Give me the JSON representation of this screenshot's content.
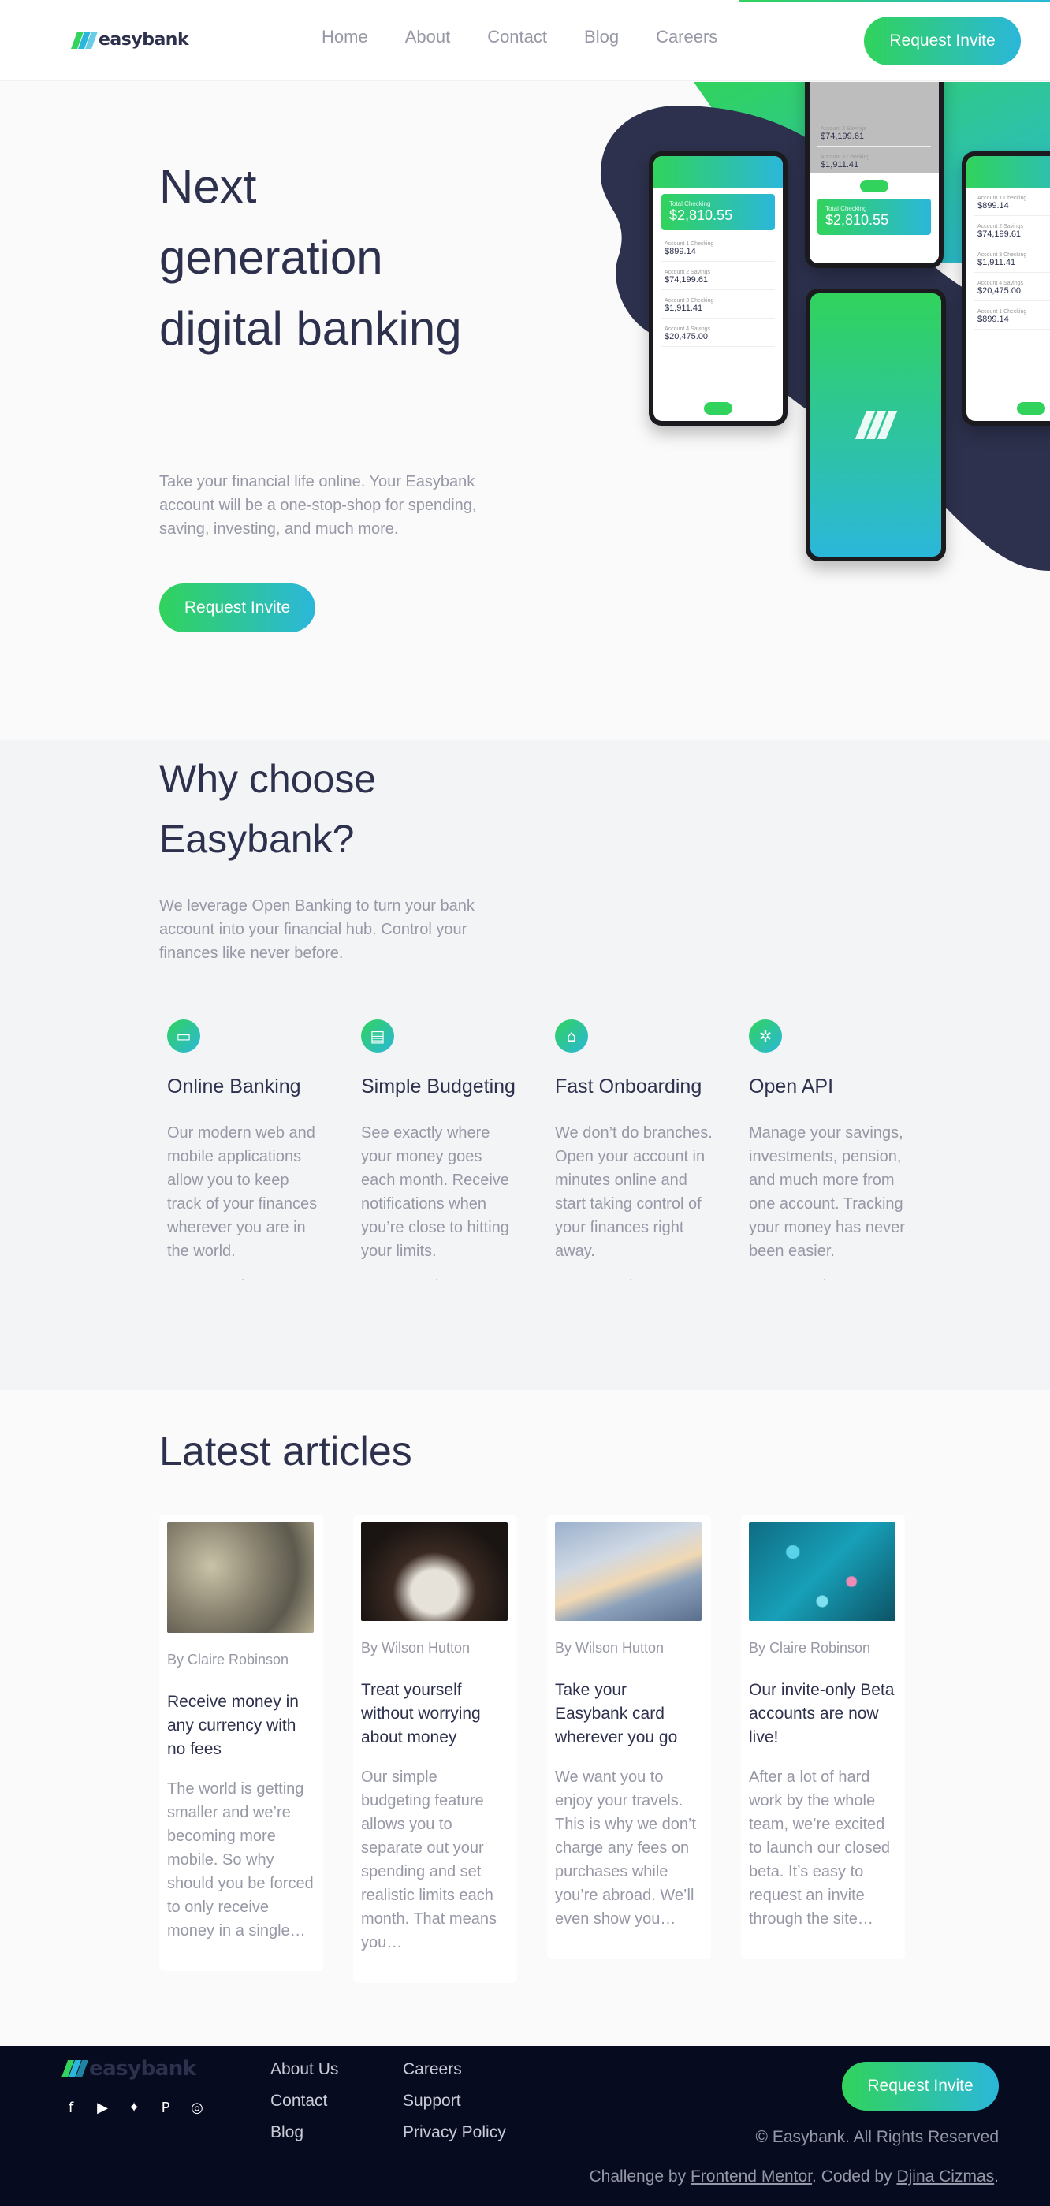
{
  "brand": {
    "name": "easybank"
  },
  "colors": {
    "accent_green": "#31d35c",
    "accent_cyan": "#2bb7da",
    "dark_blue": "#2d314d",
    "grayish": "#9698a6"
  },
  "nav": [
    "Home",
    "About",
    "Contact",
    "Blog",
    "Careers"
  ],
  "header": {
    "cta": "Request Invite"
  },
  "hero": {
    "title": "Next generation digital banking",
    "text": "Take your financial life online. Your Easybank account will be a one-stop-shop for spending, saving, investing, and much more.",
    "cta": "Request Invite",
    "mockup": {
      "total_label": "Total Checking",
      "total": "$2,810.55",
      "accounts": [
        {
          "label": "Account 1 Checking",
          "value": "$899.14"
        },
        {
          "label": "Account 2 Savings",
          "value": "$74,199.61"
        },
        {
          "label": "Account 3 Checking",
          "value": "$1,911.41"
        },
        {
          "label": "Account 4 Savings",
          "value": "$20,475.00"
        }
      ]
    }
  },
  "why": {
    "title": "Why choose Easybank?",
    "text": "We leverage Open Banking to turn your bank account into your financial hub. Control your finances like never before.",
    "features": [
      {
        "icon": "online-banking-icon",
        "title": "Online Banking",
        "text": "Our modern web and mobile applications allow you to keep track of your finances wherever you are in the world."
      },
      {
        "icon": "budgeting-icon",
        "title": "Simple Budgeting",
        "text": "See exactly where your money goes each month. Receive notifications when you’re close to hitting your limits."
      },
      {
        "icon": "onboarding-icon",
        "title": "Fast Onboarding",
        "text": "We don’t do branches. Open your account in minutes online and start taking control of your finances right away."
      },
      {
        "icon": "api-icon",
        "title": "Open API",
        "text": "Manage your savings, investments, pension, and much more from one account. Tracking your money has never been easier."
      }
    ]
  },
  "articles": {
    "title": "Latest articles",
    "items": [
      {
        "author": "By Claire Robinson",
        "title": "Receive money in any currency with no fees",
        "text": "The world is getting smaller and we’re becoming more mobile. So why should you be forced to only receive money in a single…"
      },
      {
        "author": "By Wilson Hutton",
        "title": "Treat yourself without worrying about money",
        "text": "Our simple budgeting feature allows you to separate out your spending and set realistic limits each month. That means you…"
      },
      {
        "author": "By Wilson Hutton",
        "title": "Take your Easybank card wherever you go",
        "text": "We want you to enjoy your travels. This is why we don’t charge any fees on purchases while you’re abroad. We’ll even show you…"
      },
      {
        "author": "By Claire Robinson",
        "title": "Our invite-only Beta accounts are now live!",
        "text": "After a lot of hard work by the whole team, we’re excited to launch our closed beta. It’s easy to request an invite through the site…"
      }
    ]
  },
  "footer": {
    "col1": [
      "About Us",
      "Contact",
      "Blog"
    ],
    "col2": [
      "Careers",
      "Support",
      "Privacy Policy"
    ],
    "cta": "Request Invite",
    "copyright": "© Easybank. All Rights Reserved",
    "attribution": {
      "prefix": "Challenge by",
      "mentor": "Frontend Mentor",
      "mid": ". Coded by",
      "author": "Djina Cizmas",
      "suffix": "."
    },
    "socials": [
      "facebook-icon",
      "youtube-icon",
      "twitter-icon",
      "pinterest-icon",
      "instagram-icon"
    ]
  }
}
